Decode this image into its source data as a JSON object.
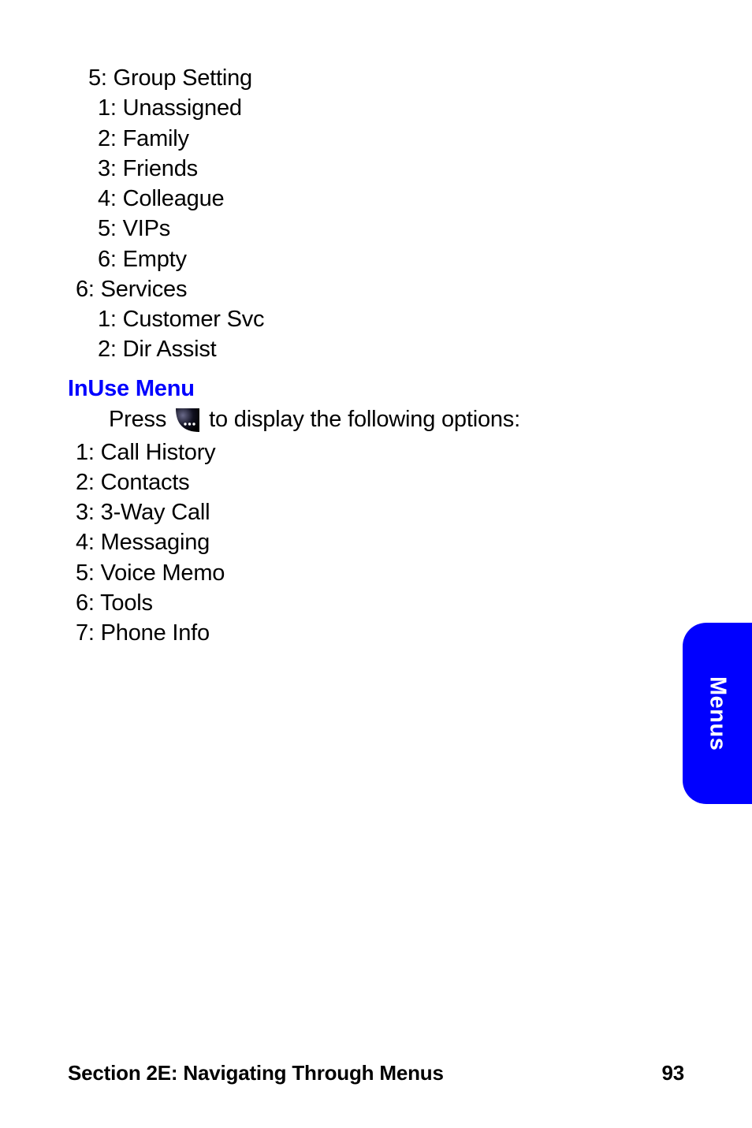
{
  "outline": {
    "group_setting": {
      "label": "5: Group Setting",
      "items": [
        "1: Unassigned",
        "2: Family",
        "3: Friends",
        "4: Colleague",
        "5: VIPs",
        "6: Empty"
      ]
    },
    "services": {
      "label": "6: Services",
      "items": [
        "1: Customer Svc",
        "2: Dir Assist"
      ]
    }
  },
  "inuse": {
    "heading": "InUse Menu",
    "press_pre": "Press",
    "press_post": " to display the following options:",
    "items": [
      "1: Call History",
      "2: Contacts",
      "3: 3-Way Call",
      "4: Messaging",
      "5: Voice Memo",
      "6: Tools",
      "7: Phone Info"
    ]
  },
  "side_tab": "Menus",
  "footer": {
    "section": "Section 2E: Navigating Through Menus",
    "page": "93"
  },
  "icon": "menu-softkey-icon"
}
